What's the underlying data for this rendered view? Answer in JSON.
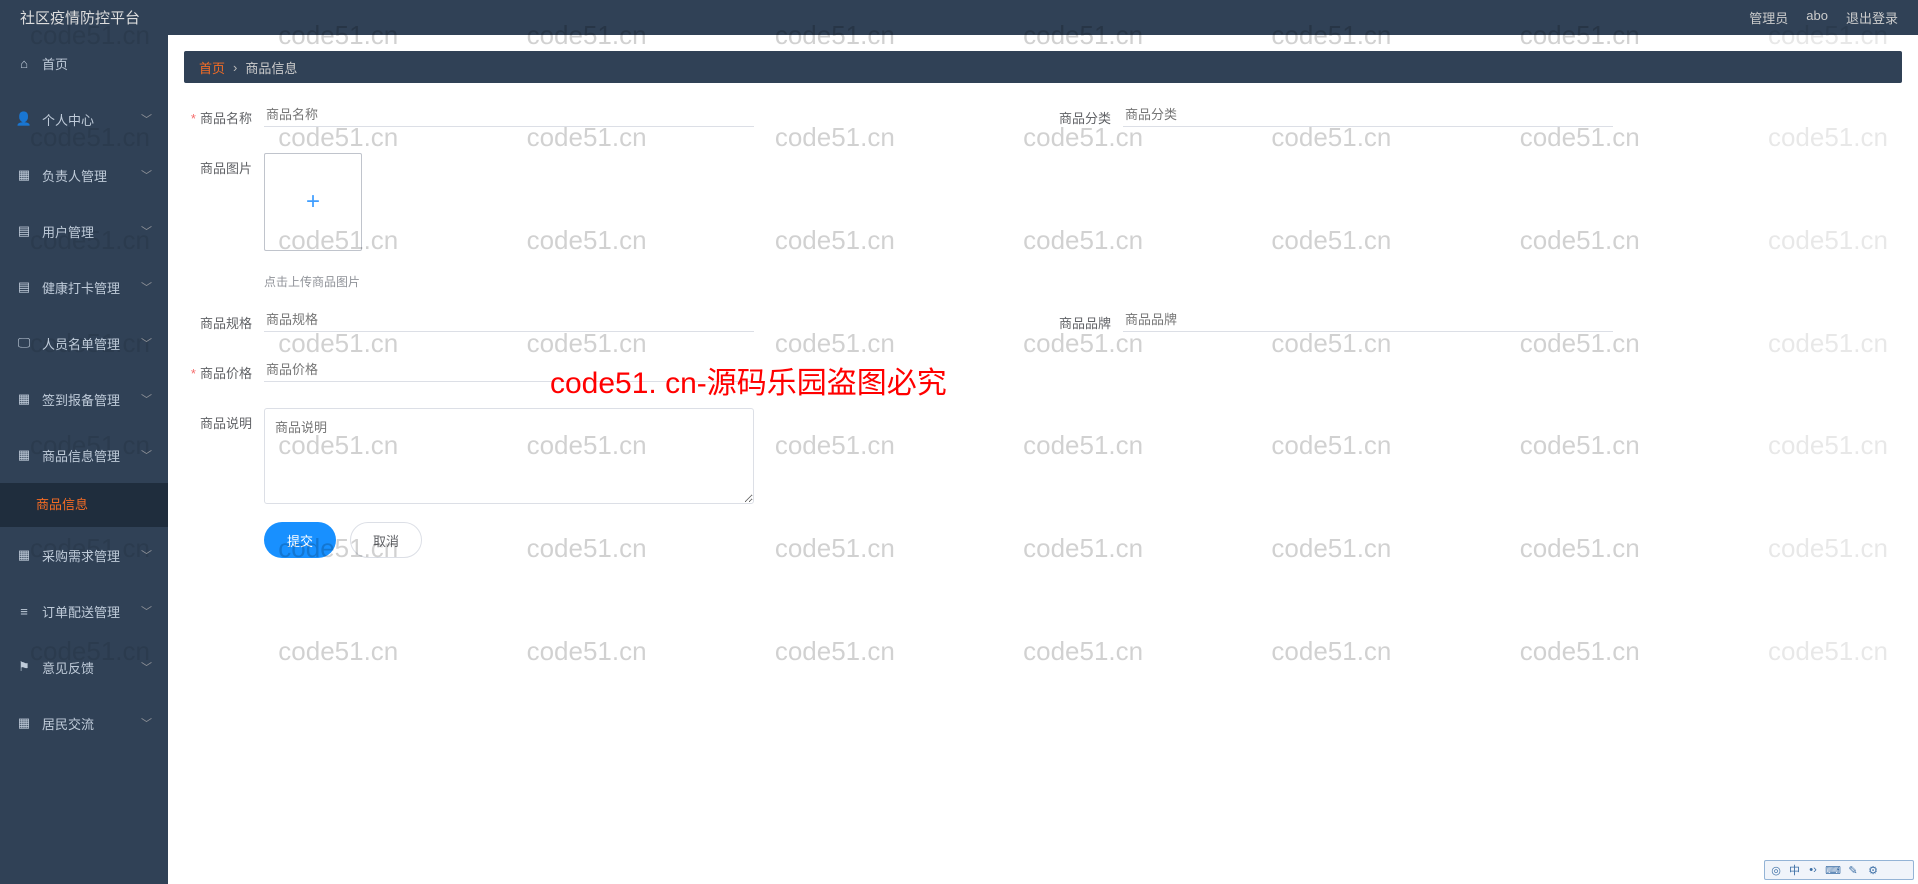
{
  "header": {
    "app_title": "社区疫情防控平台",
    "role": "管理员",
    "user": "abo",
    "logout": "退出登录"
  },
  "sidebar": {
    "items": [
      {
        "icon": "home",
        "label": "首页"
      },
      {
        "icon": "user",
        "label": "个人中心"
      },
      {
        "icon": "grid",
        "label": "负责人管理"
      },
      {
        "icon": "clipboard",
        "label": "用户管理"
      },
      {
        "icon": "clipboard",
        "label": "健康打卡管理"
      },
      {
        "icon": "monitor",
        "label": "人员名单管理"
      },
      {
        "icon": "grid",
        "label": "签到报备管理"
      },
      {
        "icon": "grid",
        "label": "商品信息管理"
      },
      {
        "icon": "grid",
        "label": "采购需求管理"
      },
      {
        "icon": "list",
        "label": "订单配送管理"
      },
      {
        "icon": "flag",
        "label": "意见反馈"
      },
      {
        "icon": "grid",
        "label": "居民交流"
      }
    ],
    "submenu_product": "商品信息"
  },
  "breadcrumb": {
    "home": "首页",
    "current": "商品信息"
  },
  "form": {
    "name_label": "商品名称",
    "name_placeholder": "商品名称",
    "category_label": "商品分类",
    "category_placeholder": "商品分类",
    "image_label": "商品图片",
    "image_hint": "点击上传商品图片",
    "spec_label": "商品规格",
    "spec_placeholder": "商品规格",
    "brand_label": "商品品牌",
    "brand_placeholder": "商品品牌",
    "price_label": "商品价格",
    "price_placeholder": "商品价格",
    "desc_label": "商品说明",
    "desc_placeholder": "商品说明",
    "submit": "提交",
    "cancel": "取消"
  },
  "watermark": "code51.cn",
  "watermark_red": "code51. cn-源码乐园盗图必究",
  "ime": {
    "char": "中"
  }
}
